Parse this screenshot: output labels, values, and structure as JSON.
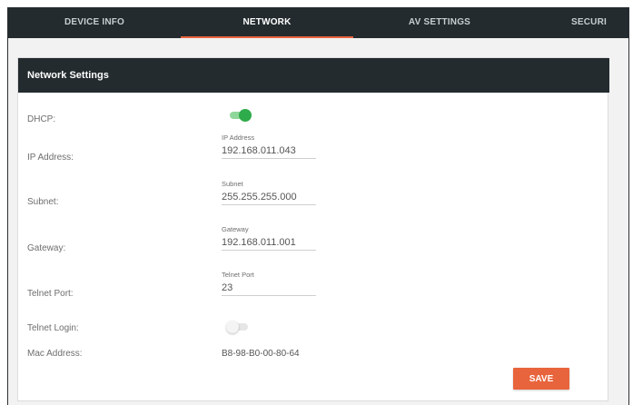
{
  "tabs": [
    {
      "label": "DEVICE INFO",
      "active": false
    },
    {
      "label": "NETWORK",
      "active": true
    },
    {
      "label": "AV SETTINGS",
      "active": false
    },
    {
      "label": "SECURI",
      "active": false
    }
  ],
  "colors": {
    "accent": "#e8643c",
    "header_bg": "#232b2f",
    "toggle_on": "#2eab4a"
  },
  "panel": {
    "title": "Network Settings"
  },
  "dhcp": {
    "label": "DHCP:",
    "enabled": true
  },
  "ip_address": {
    "label": "IP Address:",
    "field_label": "IP Address",
    "value": "192.168.011.043"
  },
  "subnet": {
    "label": "Subnet:",
    "field_label": "Subnet",
    "value": "255.255.255.000"
  },
  "gateway": {
    "label": "Gateway:",
    "field_label": "Gateway",
    "value": "192.168.011.001"
  },
  "telnet_port": {
    "label": "Telnet Port:",
    "field_label": "Telnet Port",
    "value": "23"
  },
  "telnet_login": {
    "label": "Telnet Login:",
    "enabled": false
  },
  "mac": {
    "label": "Mac Address:",
    "value": "B8-98-B0-00-80-64"
  },
  "actions": {
    "save_label": "SAVE"
  }
}
